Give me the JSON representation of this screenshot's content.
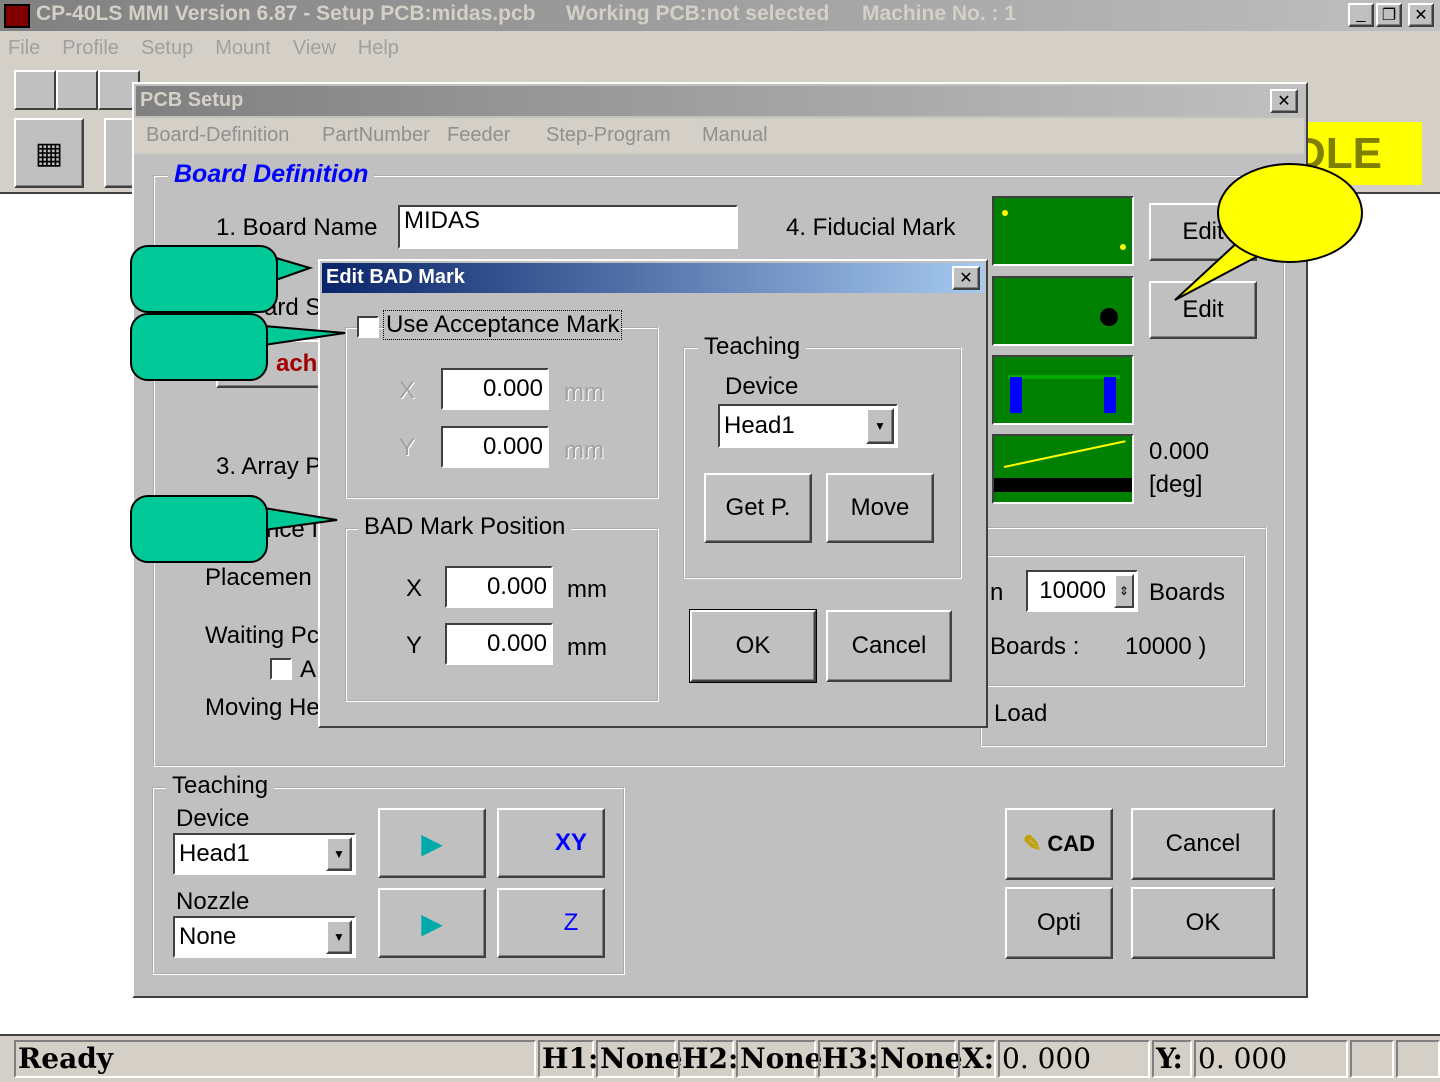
{
  "app": {
    "title": "CP-40LS MMI Version 6.87 - Setup PCB:midas.pcb",
    "working_pcb": "Working PCB:not selected",
    "machine_no": "Machine No. : 1",
    "status_badge": "IDLE"
  },
  "menu": [
    "File",
    "Profile",
    "Setup",
    "Mount",
    "View",
    "Help"
  ],
  "pcb_setup": {
    "title": "PCB Setup",
    "tabs": [
      "Board-Definition",
      "PartNumber",
      "Feeder",
      "Step-Program",
      "Manual"
    ],
    "group_title": "Board Definition",
    "board_name_label": "1. Board Name",
    "board_name_value": "MIDAS",
    "board_size_partial": "ard S",
    "machine_partial": "achi",
    "array_partial": "3. Array P",
    "ance_partial": "nce I",
    "placement_partial": "Placemen",
    "waiting_partial": "Waiting Pc",
    "auto_partial": "A",
    "moving_partial": "Moving He",
    "fiducial_label": "4. Fiducial Mark",
    "edit1": "Edit",
    "edit2": "Edit",
    "angle_value": "0.000",
    "angle_unit": "[deg]",
    "count_label_partial": "n",
    "count_value": "10000",
    "count_unit": "Boards",
    "boards_label": "Boards :",
    "boards_value": "10000 )",
    "load_label": "Load",
    "teaching": {
      "title": "Teaching",
      "device_label": "Device",
      "device_value": "Head1",
      "nozzle_label": "Nozzle",
      "nozzle_value": "None",
      "xy_label": "XY",
      "z_label": "Z"
    },
    "cad_label": "CAD",
    "cancel": "Cancel",
    "opti": "Opti",
    "ok": "OK"
  },
  "edit_bad": {
    "title": "Edit BAD Mark",
    "use_acceptance": "Use Acceptance Mark",
    "use_acceptance_checked": false,
    "acc_x_label": "X",
    "acc_x": "0.000",
    "acc_y_label": "Y",
    "acc_y": "0.000",
    "unit": "mm",
    "bad_group": "BAD Mark Position",
    "bad_x_label": "X",
    "bad_x": "0.000",
    "bad_y_label": "Y",
    "bad_y": "0.000",
    "teaching_title": "Teaching",
    "device_label": "Device",
    "device_value": "Head1",
    "getp": "Get P.",
    "move": "Move",
    "ok": "OK",
    "cancel": "Cancel"
  },
  "statusbar": {
    "ready": "Ready",
    "h1_label": "H1:",
    "h1": "None",
    "h2_label": "H2:",
    "h2": "None",
    "h3_label": "H3:",
    "h3": "None",
    "x_label": "X:",
    "x": "0. 000",
    "y_label": "Y:",
    "y": "0. 000"
  },
  "colors": {
    "callout": "#00c896",
    "highlight": "#ffff00",
    "active_title": "#0a246a"
  }
}
